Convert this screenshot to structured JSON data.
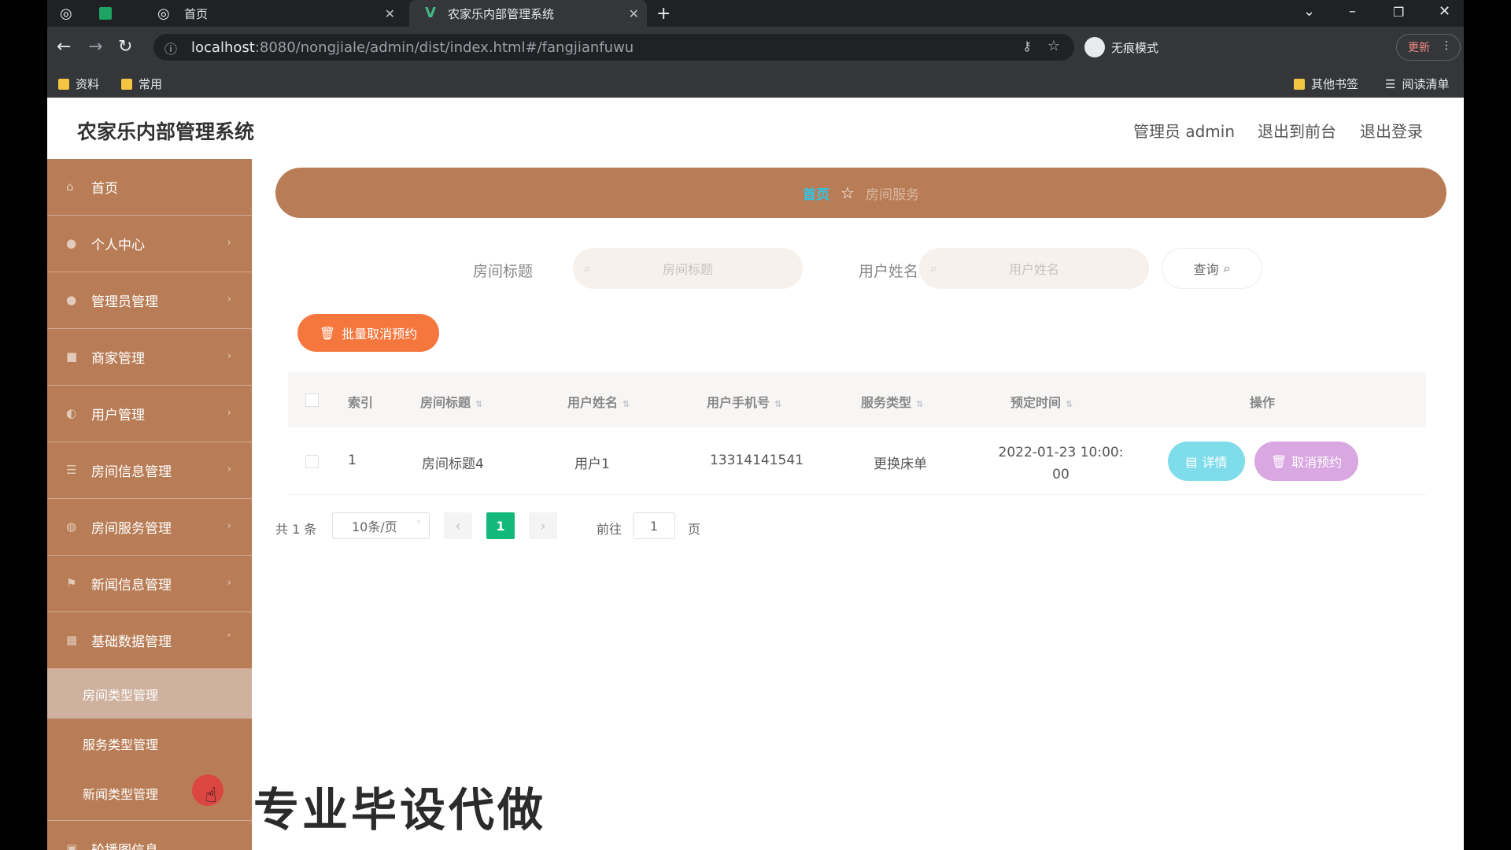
{
  "browser": {
    "tabs": [
      {
        "title": ""
      },
      {
        "title": ""
      },
      {
        "title": "首页"
      },
      {
        "title": "农家乐内部管理系统"
      }
    ],
    "url_host": "localhost",
    "url_path": ":8080/nongjiale/admin/dist/index.html#/fangjianfuwu",
    "incognito_label": "无痕模式",
    "update_label": "更新",
    "bookmarks": [
      "资料",
      "常用"
    ],
    "other_bookmarks": "其他书签",
    "reading_list": "阅读清单"
  },
  "header": {
    "app_title": "农家乐内部管理系统",
    "admin_label": "管理员 admin",
    "to_front": "退出到前台",
    "logout": "退出登录"
  },
  "sidebar": {
    "items": [
      {
        "label": "首页",
        "icon": "home-icon"
      },
      {
        "label": "个人中心",
        "icon": "user-icon"
      },
      {
        "label": "管理员管理",
        "icon": "user-icon"
      },
      {
        "label": "商家管理",
        "icon": "shop-icon"
      },
      {
        "label": "用户管理",
        "icon": "users-icon"
      },
      {
        "label": "房间信息管理",
        "icon": "list-icon"
      },
      {
        "label": "房间服务管理",
        "icon": "service-icon"
      },
      {
        "label": "新闻信息管理",
        "icon": "flag-icon"
      },
      {
        "label": "基础数据管理",
        "icon": "data-icon"
      }
    ],
    "sub_items": [
      {
        "label": "房间类型管理",
        "active": true
      },
      {
        "label": "服务类型管理",
        "active": false
      },
      {
        "label": "新闻类型管理",
        "active": false
      }
    ],
    "last_item": "轮播图信息"
  },
  "breadcrumb": {
    "home": "首页",
    "current": "房间服务"
  },
  "search": {
    "room_title_label": "房间标题",
    "room_title_placeholder": "房间标题",
    "user_name_label": "用户姓名",
    "user_name_placeholder": "用户姓名",
    "query_button": "查询"
  },
  "batch_cancel_button": "批量取消预约",
  "table": {
    "headers": [
      "索引",
      "房间标题",
      "用户姓名",
      "用户手机号",
      "服务类型",
      "预定时间",
      "操作"
    ],
    "rows": [
      {
        "index": "1",
        "room_title": "房间标题4",
        "user_name": "用户1",
        "phone": "13314141541",
        "service_type": "更换床单",
        "time_line1": "2022-01-23 10:00:",
        "time_line2": "00",
        "detail_label": "详情",
        "cancel_label": "取消预约"
      }
    ]
  },
  "pagination": {
    "total": "共 1 条",
    "page_size": "10条/页",
    "current_page": "1",
    "goto_label": "前往",
    "goto_value": "1",
    "page_unit": "页"
  },
  "watermark": "专业毕设代做",
  "colors": {
    "sidebar": "#b87d56",
    "breadcrumb_home": "#2ec4e8",
    "batch_button": "#f5773e",
    "detail_button": "#7fdcea",
    "cancel_button": "#d9a7e2",
    "active_page": "#13b97a"
  }
}
